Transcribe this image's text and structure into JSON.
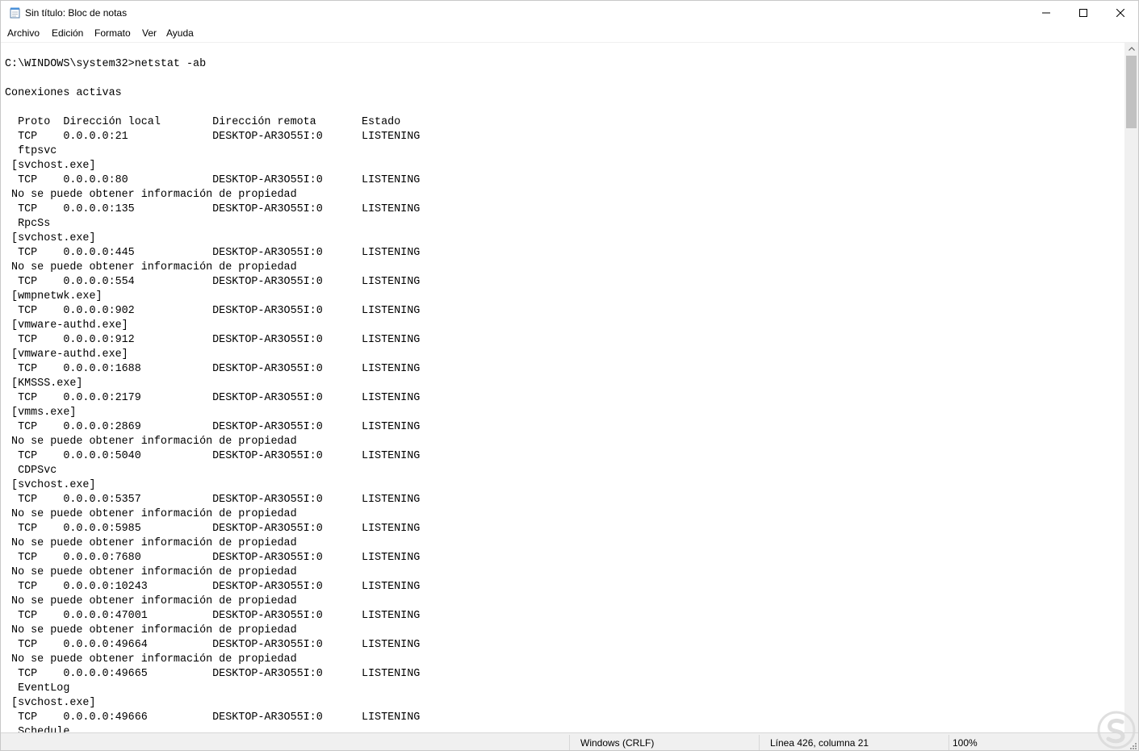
{
  "window": {
    "title": "Sin título: Bloc de notas"
  },
  "menu": {
    "items": [
      "Archivo",
      "Edición",
      "Formato",
      "Ver",
      "Ayuda"
    ]
  },
  "editor": {
    "lines": [
      "C:\\WINDOWS\\system32>netstat -ab",
      "",
      "Conexiones activas",
      "",
      "  Proto  Dirección local        Dirección remota       Estado",
      "  TCP    0.0.0.0:21             DESKTOP-AR3O55I:0      LISTENING",
      "  ftpsvc",
      " [svchost.exe]",
      "  TCP    0.0.0.0:80             DESKTOP-AR3O55I:0      LISTENING",
      " No se puede obtener información de propiedad",
      "  TCP    0.0.0.0:135            DESKTOP-AR3O55I:0      LISTENING",
      "  RpcSs",
      " [svchost.exe]",
      "  TCP    0.0.0.0:445            DESKTOP-AR3O55I:0      LISTENING",
      " No se puede obtener información de propiedad",
      "  TCP    0.0.0.0:554            DESKTOP-AR3O55I:0      LISTENING",
      " [wmpnetwk.exe]",
      "  TCP    0.0.0.0:902            DESKTOP-AR3O55I:0      LISTENING",
      " [vmware-authd.exe]",
      "  TCP    0.0.0.0:912            DESKTOP-AR3O55I:0      LISTENING",
      " [vmware-authd.exe]",
      "  TCP    0.0.0.0:1688           DESKTOP-AR3O55I:0      LISTENING",
      " [KMSSS.exe]",
      "  TCP    0.0.0.0:2179           DESKTOP-AR3O55I:0      LISTENING",
      " [vmms.exe]",
      "  TCP    0.0.0.0:2869           DESKTOP-AR3O55I:0      LISTENING",
      " No se puede obtener información de propiedad",
      "  TCP    0.0.0.0:5040           DESKTOP-AR3O55I:0      LISTENING",
      "  CDPSvc",
      " [svchost.exe]",
      "  TCP    0.0.0.0:5357           DESKTOP-AR3O55I:0      LISTENING",
      " No se puede obtener información de propiedad",
      "  TCP    0.0.0.0:5985           DESKTOP-AR3O55I:0      LISTENING",
      " No se puede obtener información de propiedad",
      "  TCP    0.0.0.0:7680           DESKTOP-AR3O55I:0      LISTENING",
      " No se puede obtener información de propiedad",
      "  TCP    0.0.0.0:10243          DESKTOP-AR3O55I:0      LISTENING",
      " No se puede obtener información de propiedad",
      "  TCP    0.0.0.0:47001          DESKTOP-AR3O55I:0      LISTENING",
      " No se puede obtener información de propiedad",
      "  TCP    0.0.0.0:49664          DESKTOP-AR3O55I:0      LISTENING",
      " No se puede obtener información de propiedad",
      "  TCP    0.0.0.0:49665          DESKTOP-AR3O55I:0      LISTENING",
      "  EventLog",
      " [svchost.exe]",
      "  TCP    0.0.0.0:49666          DESKTOP-AR3O55I:0      LISTENING",
      "  Schedule"
    ]
  },
  "statusbar": {
    "line_ending": "Windows (CRLF)",
    "position": "Línea 426, columna 21",
    "zoom": "100%"
  },
  "icons": {
    "app": "notepad-icon",
    "minimize": "minimize-icon",
    "maximize": "maximize-icon",
    "close": "close-icon",
    "scroll_up": "chevron-up-icon",
    "watermark": "brand-logo-icon"
  },
  "colors": {
    "chrome_background": "#f0f0f0",
    "scroll_thumb": "#c1c1c1",
    "watermark": "#d9d9d9"
  }
}
